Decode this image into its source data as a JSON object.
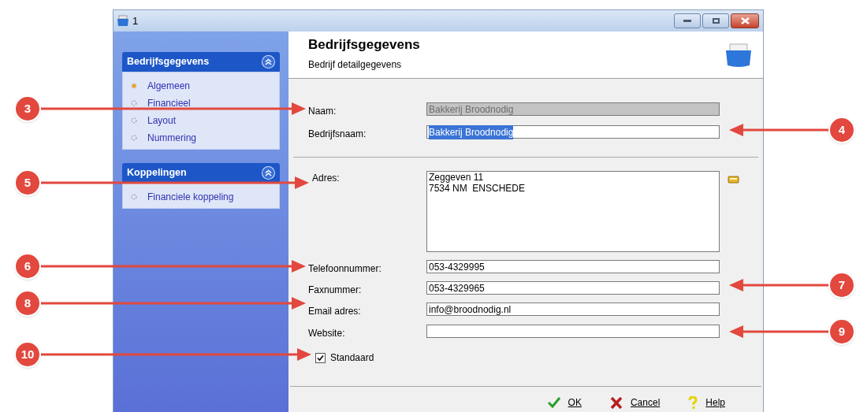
{
  "window": {
    "title": "1"
  },
  "sidebar": {
    "groups": [
      {
        "title": "Bedrijfsgegevens",
        "expanded": true,
        "items": [
          {
            "label": "Algemeen",
            "selected": true
          },
          {
            "label": "Financieel",
            "selected": false
          },
          {
            "label": "Layout",
            "selected": false
          },
          {
            "label": "Nummering",
            "selected": false
          }
        ]
      },
      {
        "title": "Koppelingen",
        "expanded": true,
        "items": [
          {
            "label": "Financiele koppeling",
            "selected": false
          }
        ]
      }
    ]
  },
  "header": {
    "title": "Bedrijfsgegevens",
    "subtitle": "Bedrijf detailgegevens"
  },
  "fields": [
    {
      "kind": "text",
      "label": "Naam:",
      "value": "Bakkerij Broodnodig",
      "disabled": true
    },
    {
      "kind": "text",
      "label": "Bedrijfsnaam:",
      "value": "Bakkerij Broodnodig",
      "disabled": false,
      "text_selected": true
    },
    {
      "kind": "divider"
    },
    {
      "kind": "multiline",
      "label": "Adres:",
      "lines": [
        "Zeggeven 11",
        "7534 NM  ENSCHEDE"
      ],
      "disabled": false
    },
    {
      "kind": "text",
      "label": "Telefoonnummer:",
      "value": "053-4329995",
      "disabled": false
    },
    {
      "kind": "text",
      "label": "Faxnummer:",
      "value": "053-4329965",
      "disabled": false
    },
    {
      "kind": "text",
      "label": "Email adres:",
      "value": "info@broodnodig.nl",
      "disabled": false
    },
    {
      "kind": "text",
      "label": "Website:",
      "disabled": false
    },
    {
      "kind": "checkbox",
      "label": "Standaard",
      "checked": true
    }
  ],
  "buttons": [
    {
      "kind": "ok",
      "label": "OK"
    },
    {
      "kind": "cancel",
      "label": "Cancel"
    },
    {
      "kind": "help",
      "label": "Help"
    }
  ],
  "callouts": [
    {
      "number": "3"
    },
    {
      "number": "4"
    },
    {
      "number": "5"
    },
    {
      "number": "6"
    },
    {
      "number": "7"
    },
    {
      "number": "8"
    },
    {
      "number": "9"
    },
    {
      "number": "10"
    }
  ]
}
